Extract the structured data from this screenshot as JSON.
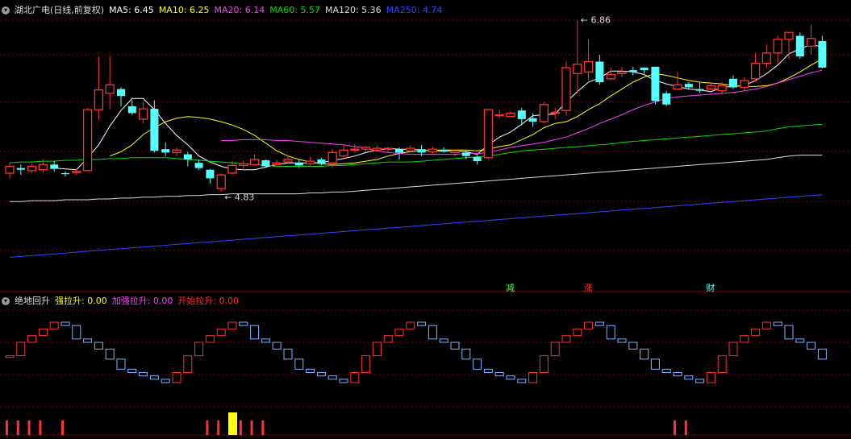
{
  "main_panel": {
    "title": "湖北广电(日线,前复权)",
    "indicators": [
      {
        "label": "MA5: 6.45",
        "color": "#ffffff"
      },
      {
        "label": "MA10: 6.25",
        "color": "#ffff00"
      },
      {
        "label": "MA20: 6.14",
        "color": "#ff40ff"
      },
      {
        "label": "MA60: 5.57",
        "color": "#00e000"
      },
      {
        "label": "MA120: 5.36",
        "color": "#dddddd"
      },
      {
        "label": "MA250: 4.74",
        "color": "#3344ff"
      }
    ],
    "high_label": "6.86",
    "low_label": "4.83",
    "markers": [
      "减",
      "涨",
      "财"
    ]
  },
  "sub_panel": {
    "title": "绝地回升",
    "indicators": [
      {
        "label": "强拉升: 0.00",
        "color": "#ffff00"
      },
      {
        "label": "加强拉升: 0.00",
        "color": "#ff40ff"
      },
      {
        "label": "开始拉升: 0.00",
        "color": "#ff3030"
      }
    ]
  },
  "colors": {
    "up": "#ff3232",
    "down": "#54ffff",
    "grid": "#8b0000"
  },
  "chart_data": {
    "type": "candlestick",
    "price_range": [
      4.0,
      7.05
    ],
    "candles": [
      [
        5.22,
        5.3,
        5.34,
        5.16
      ],
      [
        5.28,
        5.26,
        5.32,
        5.2
      ],
      [
        5.25,
        5.3,
        5.33,
        5.22
      ],
      [
        5.26,
        5.32,
        5.38,
        5.22
      ],
      [
        5.32,
        5.27,
        5.36,
        5.24
      ],
      [
        5.22,
        5.21,
        5.24,
        5.18
      ],
      [
        5.23,
        5.24,
        5.27,
        5.2
      ],
      [
        5.25,
        5.96,
        5.98,
        5.24
      ],
      [
        5.96,
        6.19,
        6.58,
        5.84
      ],
      [
        6.15,
        6.25,
        6.58,
        5.96
      ],
      [
        6.2,
        6.12,
        6.22,
        6.0
      ],
      [
        6.0,
        5.92,
        6.07,
        5.9
      ],
      [
        5.85,
        5.97,
        6.05,
        5.8
      ],
      [
        5.97,
        5.48,
        6.07,
        5.46
      ],
      [
        5.5,
        5.46,
        5.58,
        5.42
      ],
      [
        5.46,
        5.49,
        5.52,
        5.42
      ],
      [
        5.44,
        5.38,
        5.47,
        5.3
      ],
      [
        5.34,
        5.28,
        5.38,
        5.26
      ],
      [
        5.26,
        5.16,
        5.27,
        5.1
      ],
      [
        5.04,
        5.2,
        5.22,
        5.0
      ],
      [
        5.22,
        5.31,
        5.36,
        5.2
      ],
      [
        5.31,
        5.33,
        5.37,
        5.25
      ],
      [
        5.32,
        5.38,
        5.44,
        5.3
      ],
      [
        5.37,
        5.3,
        5.38,
        5.28
      ],
      [
        5.32,
        5.34,
        5.37,
        5.3
      ],
      [
        5.35,
        5.38,
        5.43,
        5.33
      ],
      [
        5.34,
        5.31,
        5.38,
        5.28
      ],
      [
        5.33,
        5.36,
        5.41,
        5.3
      ],
      [
        5.38,
        5.33,
        5.4,
        5.31
      ],
      [
        5.34,
        5.46,
        5.5,
        5.28
      ],
      [
        5.42,
        5.49,
        5.55,
        5.4
      ],
      [
        5.49,
        5.5,
        5.56,
        5.46
      ],
      [
        5.5,
        5.52,
        5.54,
        5.47
      ],
      [
        5.49,
        5.51,
        5.54,
        5.47
      ],
      [
        5.5,
        5.51,
        5.53,
        5.46
      ],
      [
        5.5,
        5.46,
        5.52,
        5.38
      ],
      [
        5.48,
        5.51,
        5.54,
        5.46
      ],
      [
        5.5,
        5.46,
        5.55,
        5.42
      ],
      [
        5.47,
        5.5,
        5.53,
        5.44
      ],
      [
        5.49,
        5.47,
        5.52,
        5.46
      ],
      [
        5.46,
        5.48,
        5.49,
        5.42
      ],
      [
        5.46,
        5.42,
        5.48,
        5.38
      ],
      [
        5.41,
        5.36,
        5.43,
        5.32
      ],
      [
        5.4,
        5.96,
        5.96,
        5.38
      ],
      [
        5.89,
        5.9,
        5.96,
        5.86
      ],
      [
        5.88,
        5.92,
        5.94,
        5.87
      ],
      [
        5.95,
        5.85,
        5.98,
        5.78
      ],
      [
        5.86,
        5.82,
        5.92,
        5.76
      ],
      [
        5.82,
        6.02,
        6.05,
        5.8
      ],
      [
        5.92,
        5.93,
        5.98,
        5.85
      ],
      [
        5.95,
        6.45,
        6.52,
        5.89
      ],
      [
        6.38,
        6.49,
        7.0,
        6.15
      ],
      [
        6.4,
        6.52,
        6.78,
        6.3
      ],
      [
        6.52,
        6.28,
        6.6,
        6.25
      ],
      [
        6.32,
        6.37,
        6.45,
        6.3
      ],
      [
        6.38,
        6.4,
        6.46,
        6.34
      ],
      [
        6.42,
        6.4,
        6.46,
        6.36
      ],
      [
        6.45,
        6.42,
        6.45,
        6.38
      ],
      [
        6.46,
        6.06,
        6.46,
        6.02
      ],
      [
        6.15,
        6.02,
        6.18,
        6.0
      ],
      [
        6.2,
        6.25,
        6.4,
        6.2
      ],
      [
        6.26,
        6.22,
        6.28,
        6.2
      ],
      [
        6.2,
        6.18,
        6.28,
        6.15
      ],
      [
        6.2,
        6.24,
        6.28,
        6.2
      ],
      [
        6.18,
        6.24,
        6.28,
        6.14
      ],
      [
        6.32,
        6.22,
        6.36,
        6.2
      ],
      [
        6.22,
        6.3,
        6.34,
        6.18
      ],
      [
        6.32,
        6.5,
        6.62,
        6.28
      ],
      [
        6.5,
        6.62,
        6.72,
        6.44
      ],
      [
        6.62,
        6.78,
        6.82,
        6.5
      ],
      [
        6.78,
        6.86,
        6.86,
        6.55
      ],
      [
        6.82,
        6.58,
        6.86,
        6.55
      ],
      [
        6.7,
        6.79,
        6.95,
        6.6
      ],
      [
        6.76,
        6.45,
        6.82,
        6.44
      ]
    ],
    "ma": {
      "MA5": [
        null,
        null,
        null,
        null,
        5.28,
        5.27,
        5.26,
        5.4,
        5.55,
        5.77,
        5.95,
        6.09,
        6.09,
        5.96,
        5.8,
        5.66,
        5.55,
        5.42,
        5.35,
        5.3,
        5.27,
        5.26,
        5.26,
        5.29,
        5.32,
        5.34,
        5.34,
        5.34,
        5.34,
        5.37,
        5.39,
        5.42,
        5.46,
        5.49,
        5.51,
        5.5,
        5.5,
        5.49,
        5.48,
        5.48,
        5.48,
        5.47,
        5.44,
        5.55,
        5.64,
        5.7,
        5.79,
        5.89,
        5.9,
        5.91,
        6.05,
        6.17,
        6.28,
        6.33,
        6.41,
        6.41,
        6.4,
        6.37,
        6.3,
        6.26,
        6.23,
        6.2,
        6.19,
        6.17,
        6.22,
        6.23,
        6.24,
        6.3,
        6.38,
        6.48,
        6.61,
        6.67,
        6.72,
        6.69
      ],
      "MA10": [
        null,
        null,
        null,
        null,
        null,
        null,
        null,
        null,
        null,
        5.42,
        5.47,
        5.55,
        5.67,
        5.75,
        5.82,
        5.86,
        5.88,
        5.87,
        5.85,
        5.82,
        5.78,
        5.73,
        5.66,
        5.57,
        5.48,
        5.42,
        5.38,
        5.35,
        5.33,
        5.32,
        5.33,
        5.34,
        5.36,
        5.38,
        5.42,
        5.45,
        5.47,
        5.48,
        5.49,
        5.49,
        5.49,
        5.49,
        5.48,
        5.5,
        5.53,
        5.55,
        5.61,
        5.67,
        5.75,
        5.8,
        5.82,
        5.88,
        5.96,
        6.03,
        6.12,
        6.2,
        6.28,
        6.34,
        6.38,
        6.36,
        6.33,
        6.3,
        6.28,
        6.27,
        6.26,
        6.24,
        6.23,
        6.23,
        6.24,
        6.27,
        6.33,
        6.4,
        6.48,
        6.55
      ],
      "MA20": [
        null,
        null,
        null,
        null,
        null,
        null,
        null,
        null,
        null,
        null,
        null,
        null,
        null,
        null,
        null,
        null,
        null,
        null,
        null,
        5.6,
        5.6,
        5.61,
        5.61,
        5.61,
        5.6,
        5.6,
        5.59,
        5.58,
        5.57,
        5.56,
        5.55,
        5.53,
        5.51,
        5.48,
        5.46,
        5.45,
        5.44,
        5.44,
        5.44,
        5.44,
        5.44,
        5.45,
        5.45,
        5.46,
        5.49,
        5.52,
        5.54,
        5.56,
        5.58,
        5.61,
        5.64,
        5.69,
        5.74,
        5.8,
        5.85,
        5.9,
        5.96,
        6.01,
        6.05,
        6.09,
        6.11,
        6.12,
        6.13,
        6.14,
        6.15,
        6.16,
        6.18,
        6.2,
        6.23,
        6.27,
        6.31,
        6.35,
        6.39,
        6.42
      ],
      "MA60": [
        5.34,
        5.35,
        5.35,
        5.36,
        5.36,
        5.37,
        5.37,
        5.38,
        5.38,
        5.39,
        5.39,
        5.4,
        5.4,
        5.4,
        5.4,
        5.39,
        5.38,
        5.37,
        5.36,
        5.35,
        5.34,
        5.33,
        5.32,
        5.31,
        5.3,
        5.3,
        5.3,
        5.3,
        5.3,
        5.31,
        5.31,
        5.32,
        5.33,
        5.34,
        5.35,
        5.35,
        5.35,
        5.36,
        5.37,
        5.38,
        5.39,
        5.4,
        5.41,
        5.42,
        5.44,
        5.46,
        5.48,
        5.49,
        5.5,
        5.51,
        5.52,
        5.53,
        5.54,
        5.55,
        5.56,
        5.58,
        5.59,
        5.6,
        5.61,
        5.62,
        5.63,
        5.64,
        5.65,
        5.66,
        5.67,
        5.68,
        5.69,
        5.7,
        5.71,
        5.74,
        5.76,
        5.77,
        5.78,
        5.79
      ],
      "MA120": [
        4.89,
        4.89,
        4.9,
        4.9,
        4.9,
        4.91,
        4.91,
        4.91,
        4.92,
        4.92,
        4.93,
        4.93,
        4.94,
        4.94,
        4.95,
        4.95,
        4.96,
        4.96,
        4.97,
        4.97,
        4.98,
        4.98,
        4.98,
        4.98,
        4.98,
        4.98,
        4.98,
        4.99,
        4.99,
        5.0,
        5.0,
        5.01,
        5.02,
        5.03,
        5.04,
        5.05,
        5.06,
        5.07,
        5.08,
        5.09,
        5.1,
        5.11,
        5.12,
        5.13,
        5.14,
        5.15,
        5.16,
        5.17,
        5.18,
        5.19,
        5.2,
        5.21,
        5.22,
        5.23,
        5.24,
        5.25,
        5.26,
        5.27,
        5.28,
        5.29,
        5.3,
        5.31,
        5.32,
        5.33,
        5.34,
        5.35,
        5.36,
        5.37,
        5.38,
        5.4,
        5.42,
        5.43,
        5.43,
        5.43
      ],
      "MA250": [
        4.24,
        4.25,
        4.26,
        4.27,
        4.28,
        4.29,
        4.3,
        4.31,
        4.32,
        4.33,
        4.34,
        4.35,
        4.36,
        4.37,
        4.38,
        4.39,
        4.4,
        4.41,
        4.42,
        4.43,
        4.44,
        4.45,
        4.46,
        4.47,
        4.48,
        4.49,
        4.5,
        4.51,
        4.52,
        4.53,
        4.54,
        4.55,
        4.56,
        4.57,
        4.58,
        4.59,
        4.6,
        4.61,
        4.62,
        4.63,
        4.64,
        4.65,
        4.66,
        4.67,
        4.68,
        4.69,
        4.7,
        4.71,
        4.72,
        4.73,
        4.74,
        4.75,
        4.76,
        4.77,
        4.78,
        4.79,
        4.8,
        4.81,
        4.82,
        4.83,
        4.84,
        4.85,
        4.86,
        4.87,
        4.88,
        4.89,
        4.9,
        4.91,
        4.92,
        4.93,
        4.94,
        4.95,
        4.96,
        4.97
      ]
    },
    "sub_levels": [
      8,
      12,
      14,
      16,
      18,
      17,
      13,
      12,
      10,
      7,
      4,
      3,
      2,
      1,
      0,
      3,
      8,
      12,
      14,
      16,
      18,
      17,
      13,
      12,
      10,
      7,
      4,
      3,
      2,
      1,
      0,
      3,
      8,
      12,
      14,
      16,
      18,
      17,
      13,
      12,
      10,
      7,
      4,
      3,
      2,
      1,
      0,
      3,
      8,
      12,
      14,
      16,
      18,
      17,
      13,
      12,
      10,
      7,
      4,
      3,
      2,
      1,
      0,
      3,
      8,
      12,
      14,
      16,
      18,
      17,
      13,
      12,
      10,
      7
    ],
    "signal_bars": [
      0,
      1,
      2,
      3,
      5,
      18,
      19,
      20,
      21,
      22,
      23,
      60,
      61
    ]
  }
}
